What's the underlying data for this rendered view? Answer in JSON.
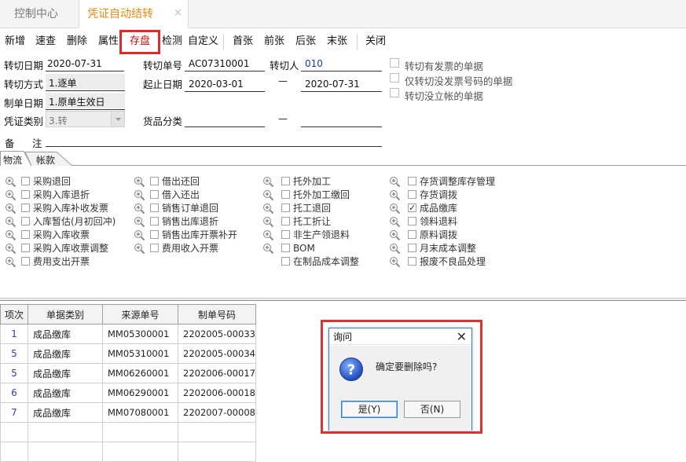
{
  "tabs": {
    "home": "控制中心",
    "active": "凭证自动结转",
    "close_glyph": "×"
  },
  "toolbar": {
    "new": "新增",
    "query": "速查",
    "delete": "删除",
    "props": "属性",
    "save": "存盘",
    "check": "检测",
    "custom": "自定义",
    "first": "首张",
    "prev": "前张",
    "next": "后张",
    "last": "末张",
    "close": "关闭"
  },
  "form": {
    "transfer_date_label": "转切日期",
    "transfer_date": "2020-07-31",
    "transfer_no_label": "转切单号",
    "transfer_no": "AC07310001",
    "transferrer_label": "转切人",
    "transferrer": "010",
    "mode_label": "转切方式",
    "mode": "1.逐单",
    "range_label": "起止日期",
    "range_start": "2020-03-01",
    "range_dash": "—",
    "range_end": "2020-07-31",
    "made_date_label": "制单日期",
    "made_date": "1.原单生效日",
    "voucher_type_label": "凭证类别",
    "voucher_type": "3.转",
    "goods_class_label": "货品分类",
    "goods_dash": "—",
    "remark_label_1": "备",
    "remark_label_2": "注",
    "opt_invoiced": "转切有发票的单据",
    "opt_no_invoice_no": "仅转切没发票号码的单据",
    "opt_no_account": "转切没立帐的单据"
  },
  "subtabs": {
    "logistics": "物流",
    "accounts": "帐款"
  },
  "options": {
    "col1": [
      "采购退回",
      "采购入库退折",
      "采购入库补收发票",
      "入库暂估(月初回冲)",
      "采购入库收票",
      "采购入库收票调整",
      "费用支出开票"
    ],
    "col2": [
      "借出还回",
      "借入还出",
      "销售订单退回",
      "销售出库退折",
      "销售出库开票补开",
      "费用收入开票"
    ],
    "col3": [
      "托外加工",
      "托外加工缴回",
      "托工退回",
      "托工折让",
      "非生产领退料",
      "BOM",
      "在制品成本调整"
    ],
    "col4": [
      "存货调整库存管理",
      "存货调拨",
      "成品缴库",
      "领料退料",
      "原料调拨",
      "月末成本调整",
      "报废不良品处理"
    ]
  },
  "table": {
    "headers": [
      "项次",
      "单据类别",
      "来源单号",
      "制单号码"
    ],
    "rows": [
      [
        "1",
        "成品缴库",
        "MM05300001",
        "2202005-00033"
      ],
      [
        "5",
        "成品缴库",
        "MM05310001",
        "2202005-00034"
      ],
      [
        "5",
        "成品缴库",
        "MM06260001",
        "2202006-00017"
      ],
      [
        "6",
        "成品缴库",
        "MM06290001",
        "2202006-00018"
      ],
      [
        "7",
        "成品缴库",
        "MM07080001",
        "2202007-00008"
      ]
    ]
  },
  "dialog": {
    "title": "询问",
    "message": "确定要删除吗?",
    "yes": "是(Y)",
    "no": "否(N)",
    "close_glyph": "✕"
  },
  "colors": {
    "accent": "#e98a12",
    "highlight_red": "#e02a2a",
    "link_blue": "#1a3ea8",
    "dialog_border": "#2f7fc4"
  }
}
